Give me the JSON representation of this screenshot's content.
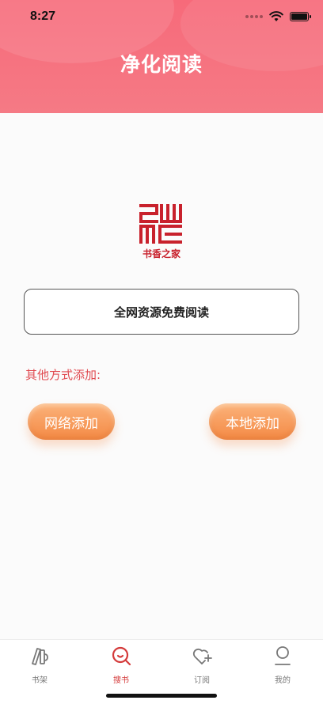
{
  "status": {
    "time": "8:27"
  },
  "header": {
    "title": "净化阅读"
  },
  "logo": {
    "text": "书香之家",
    "brand_color": "#c8212c"
  },
  "main_button": {
    "label": "全网资源免费阅读"
  },
  "other": {
    "label": "其他方式添加:",
    "network_button": "网络添加",
    "local_button": "本地添加"
  },
  "tabs": [
    {
      "label": "书架",
      "icon": "bookshelf-icon"
    },
    {
      "label": "搜书",
      "icon": "search-book-icon",
      "active": true
    },
    {
      "label": "订阅",
      "icon": "subscribe-heart-icon"
    },
    {
      "label": "我的",
      "icon": "profile-icon"
    }
  ],
  "colors": {
    "header": "#f76a7a",
    "accent_orange": "#f48a45",
    "active_tab": "#d43a3a"
  }
}
